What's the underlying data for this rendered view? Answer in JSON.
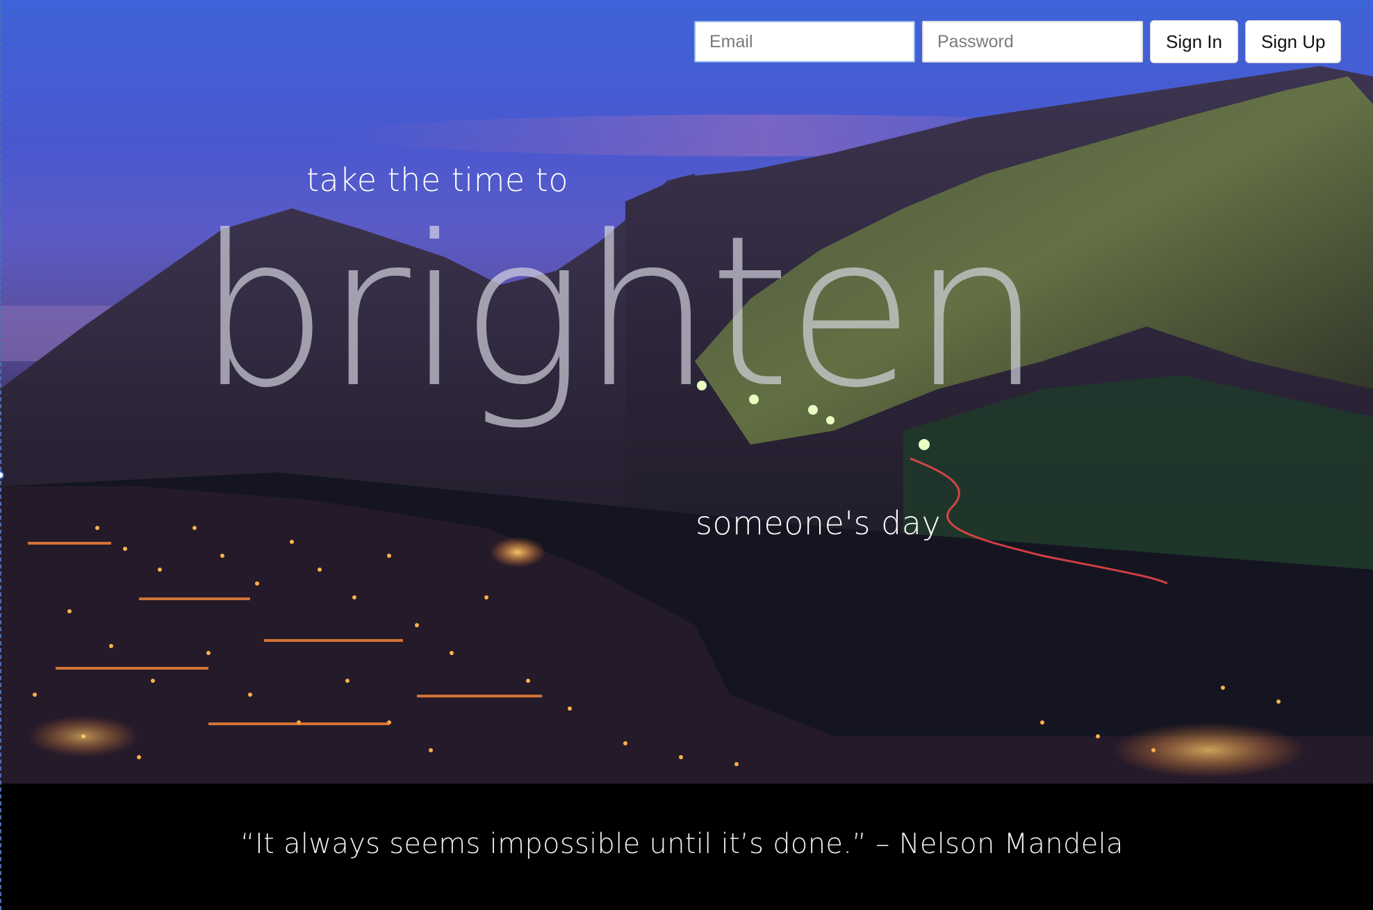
{
  "auth": {
    "email_placeholder": "Email",
    "password_placeholder": "Password",
    "sign_in_label": "Sign In",
    "sign_up_label": "Sign Up"
  },
  "hero": {
    "line1": "take the time to",
    "headline": "brighten",
    "line3": "someone's day"
  },
  "footer": {
    "quote": "“It always seems impossible until it’s done.” – Nelson Mandela"
  },
  "colors": {
    "sky_top": "#3f63d8",
    "quote_bar": "#000000",
    "city_lights": "#ffb24a"
  }
}
